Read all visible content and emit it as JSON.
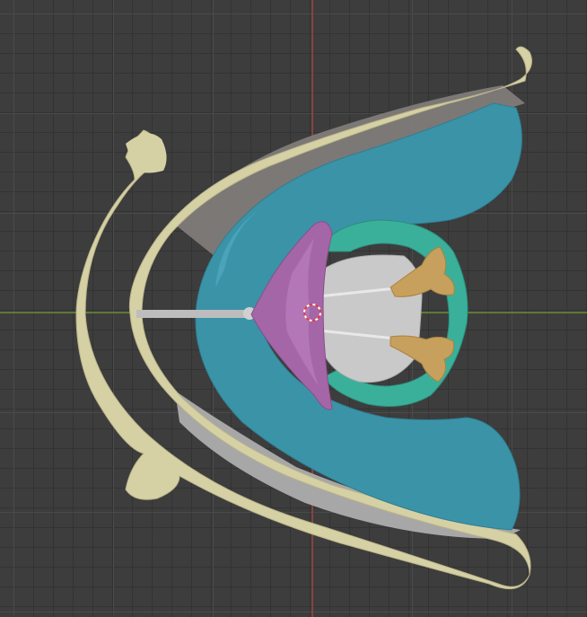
{
  "viewport": {
    "name": "3D Viewport",
    "background_color": "#3d3d3d",
    "grid_minor_color": "#333333",
    "grid_major_color": "#4a4a4a",
    "axis_x_color": "#6b9b2f",
    "axis_y_color": "#b0433f"
  },
  "scene": {
    "objects": [
      {
        "name": "hyoid-bone",
        "color": "#d6d1a4"
      },
      {
        "name": "thyroid-cartilage-membrane",
        "color": "#3b93a8"
      },
      {
        "name": "epiglottis",
        "color": "#a566a8"
      },
      {
        "name": "cricoid-ring",
        "color": "#3ab09a"
      },
      {
        "name": "arytenoid-cartilages",
        "color": "#c7a05d"
      },
      {
        "name": "vocal-folds",
        "color": "#c9c9c9"
      },
      {
        "name": "gray-wedge-membrane",
        "color": "#a7a7a7"
      }
    ],
    "cursor": "3d-cursor"
  }
}
